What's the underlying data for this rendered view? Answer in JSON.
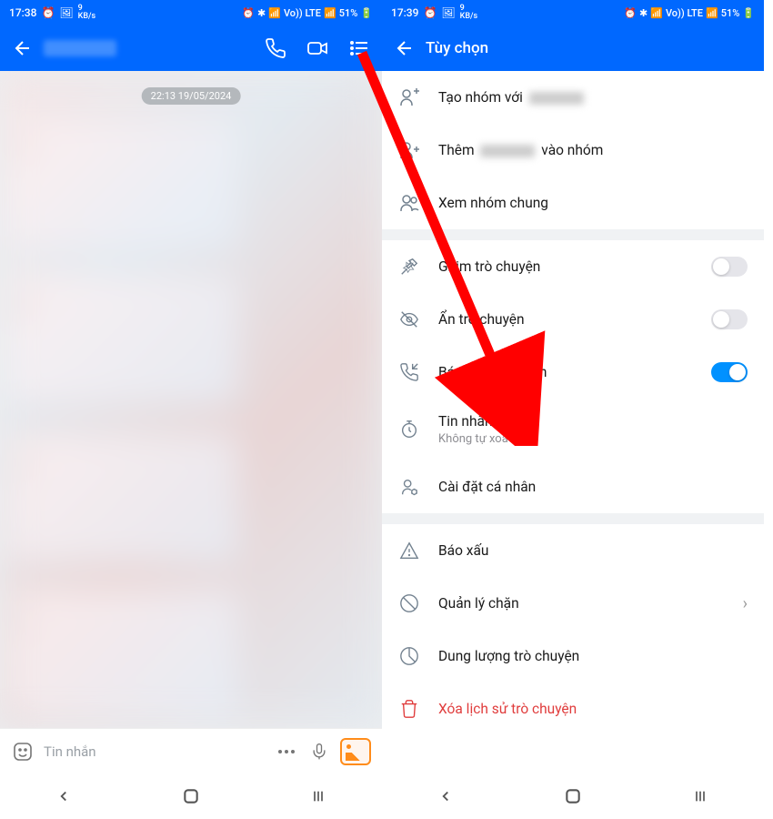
{
  "statusBar": {
    "left": {
      "time": "17:38",
      "timeRight": "17:39",
      "speed": "9",
      "unit": "KB/s"
    },
    "right": {
      "network": "Vo)) LTE",
      "battery": "51%"
    }
  },
  "chatScreen": {
    "timeBadge": "22:13 19/05/2024",
    "inputPlaceholder": "Tin nhắn"
  },
  "optionsScreen": {
    "title": "Tùy chọn",
    "items": {
      "createGroup": {
        "prefix": "Tạo nhóm với ",
        "suffix": ""
      },
      "addToGroup": {
        "prefix": "Thêm ",
        "suffix": " vào nhóm"
      },
      "viewGroups": "Xem nhóm chung",
      "pinChat": "Ghim trò chuyện",
      "hideChat": "Ẩn trò chuyện",
      "incomingCall": "Báo cuộc gọi đến",
      "autoDelete": {
        "label": "Tin nhắn tự xoá",
        "sub": "Không tự xoá"
      },
      "personalSettings": "Cài đặt cá nhân",
      "report": "Báo xấu",
      "blockManage": "Quản lý chặn",
      "storage": "Dung lượng trò chuyện",
      "deleteHistory": "Xóa lịch sử trò chuyện"
    }
  }
}
